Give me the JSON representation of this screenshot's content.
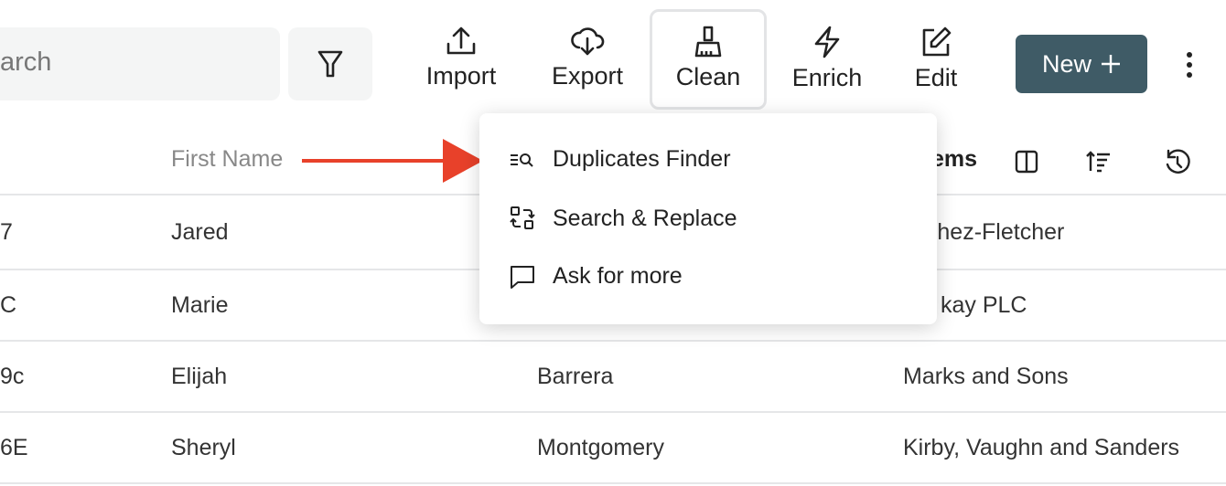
{
  "toolbar": {
    "search_placeholder": "arch",
    "import": "Import",
    "export": "Export",
    "clean": "Clean",
    "enrich": "Enrich",
    "edit": "Edit",
    "new": "New",
    "new_icon": "plus-icon",
    "accent": "#3f5b66"
  },
  "table": {
    "headers": {
      "first_name": "First Name",
      "company": "ems"
    },
    "rows": [
      {
        "id": "7",
        "first": "Jared",
        "last": "",
        "company": "nchez-Fletcher"
      },
      {
        "id": "C",
        "first": "Marie",
        "last": "",
        "company": "kay PLC"
      },
      {
        "id": "9c",
        "first": "Elijah",
        "last": "Barrera",
        "company": "Marks and Sons"
      },
      {
        "id": "6E",
        "first": "Sheryl",
        "last": "Montgomery",
        "company": "Kirby, Vaughn and Sanders"
      }
    ]
  },
  "menu": {
    "items": [
      {
        "label": "Duplicates Finder",
        "icon": "duplicates-search-icon"
      },
      {
        "label": "Search & Replace",
        "icon": "search-replace-icon"
      },
      {
        "label": "Ask for more",
        "icon": "chat-icon"
      }
    ]
  },
  "annotation": {
    "arrow_color": "#e8412a"
  }
}
